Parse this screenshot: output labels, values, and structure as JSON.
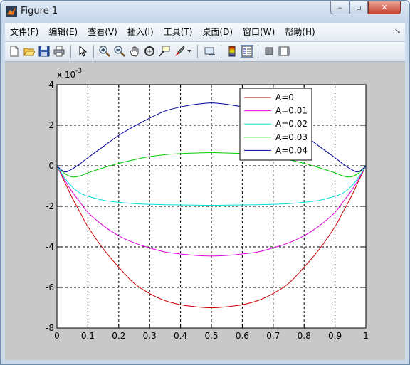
{
  "window": {
    "title": "Figure 1",
    "min_glyph": "–",
    "max_glyph": "▫",
    "close_glyph": "✕"
  },
  "menubar": {
    "items": [
      {
        "label": "文件(F)"
      },
      {
        "label": "编辑(E)"
      },
      {
        "label": "查看(V)"
      },
      {
        "label": "插入(I)"
      },
      {
        "label": "工具(T)"
      },
      {
        "label": "桌面(D)"
      },
      {
        "label": "窗口(W)"
      },
      {
        "label": "帮助(H)"
      }
    ],
    "overflow_glyph": "↘"
  },
  "toolbar": {
    "tools": [
      {
        "name": "new-figure-icon"
      },
      {
        "name": "open-file-icon"
      },
      {
        "name": "save-icon"
      },
      {
        "name": "print-icon"
      },
      {
        "name": "edit-plot-arrow-icon"
      },
      {
        "name": "zoom-in-icon"
      },
      {
        "name": "zoom-out-icon"
      },
      {
        "name": "pan-hand-icon"
      },
      {
        "name": "rotate-3d-icon"
      },
      {
        "name": "data-cursor-icon"
      },
      {
        "name": "brush-icon"
      },
      {
        "name": "link-plot-icon"
      },
      {
        "name": "insert-colorbar-icon"
      },
      {
        "name": "insert-legend-icon"
      },
      {
        "name": "hide-plot-tools-icon"
      },
      {
        "name": "show-plot-tools-icon"
      }
    ]
  },
  "colors": {
    "A0": "#cc0000",
    "A001": "#dd00dd",
    "A002": "#00dddd",
    "A003": "#00cc00",
    "A004": "#000099"
  },
  "chart_data": {
    "type": "line",
    "title": "",
    "xlabel": "",
    "ylabel": "",
    "y_exponent_label": "x 10",
    "y_exponent_power": "-3",
    "xlim": [
      0,
      1
    ],
    "ylim": [
      -8,
      4
    ],
    "y_scale_factor": 0.001,
    "grid": true,
    "legend_position": "top-right",
    "xticks": [
      "0",
      "0.1",
      "0.2",
      "0.3",
      "0.4",
      "0.5",
      "0.6",
      "0.7",
      "0.8",
      "0.9",
      "1"
    ],
    "yticks": [
      "4",
      "2",
      "0",
      "-2",
      "-4",
      "-6",
      "-8"
    ],
    "x": [
      0,
      0.025,
      0.05,
      0.075,
      0.1,
      0.15,
      0.2,
      0.25,
      0.3,
      0.35,
      0.4,
      0.45,
      0.5,
      0.55,
      0.6,
      0.65,
      0.7,
      0.75,
      0.8,
      0.85,
      0.9,
      0.925,
      0.95,
      0.975,
      1
    ],
    "series": [
      {
        "name": "A=0",
        "color": "#cc0000",
        "values": [
          0,
          -0.8,
          -1.6,
          -2.3,
          -3.0,
          -4.1,
          -5.0,
          -5.8,
          -6.3,
          -6.65,
          -6.85,
          -6.95,
          -7.0,
          -6.95,
          -6.85,
          -6.65,
          -6.3,
          -5.8,
          -5.0,
          -4.1,
          -3.0,
          -2.3,
          -1.6,
          -0.8,
          0
        ]
      },
      {
        "name": "A=0.01",
        "color": "#dd00dd",
        "values": [
          0,
          -0.7,
          -1.3,
          -1.8,
          -2.3,
          -2.95,
          -3.45,
          -3.8,
          -4.05,
          -4.25,
          -4.35,
          -4.42,
          -4.45,
          -4.42,
          -4.35,
          -4.25,
          -4.05,
          -3.8,
          -3.45,
          -2.95,
          -2.3,
          -1.8,
          -1.3,
          -0.7,
          0
        ]
      },
      {
        "name": "A=0.02",
        "color": "#00dddd",
        "values": [
          0,
          -0.6,
          -1.05,
          -1.35,
          -1.5,
          -1.7,
          -1.8,
          -1.87,
          -1.9,
          -1.92,
          -1.93,
          -1.94,
          -1.95,
          -1.94,
          -1.93,
          -1.92,
          -1.9,
          -1.87,
          -1.8,
          -1.7,
          -1.5,
          -1.35,
          -1.05,
          -0.6,
          0
        ]
      },
      {
        "name": "A=0.03",
        "color": "#00cc00",
        "values": [
          0,
          -0.38,
          -0.55,
          -0.5,
          -0.35,
          -0.1,
          0.12,
          0.3,
          0.45,
          0.55,
          0.6,
          0.63,
          0.65,
          0.63,
          0.6,
          0.55,
          0.45,
          0.3,
          0.12,
          -0.1,
          -0.35,
          -0.5,
          -0.55,
          -0.38,
          0
        ]
      },
      {
        "name": "A=0.04",
        "color": "#000099",
        "values": [
          0,
          -0.3,
          -0.15,
          0.1,
          0.4,
          0.95,
          1.5,
          1.95,
          2.35,
          2.7,
          2.9,
          3.03,
          3.1,
          3.03,
          2.9,
          2.7,
          2.35,
          1.95,
          1.5,
          0.95,
          0.4,
          0.1,
          -0.15,
          -0.3,
          0
        ]
      }
    ]
  }
}
